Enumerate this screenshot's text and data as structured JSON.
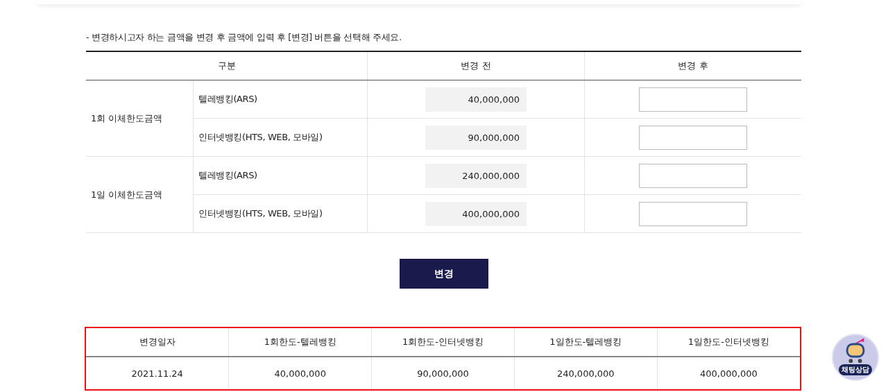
{
  "instruction": "- 변경하시고자 하는 금액을 변경 후 금액에 입력 후 [변경] 버튼을 선택해 주세요.",
  "limit_table": {
    "columns": [
      "구분",
      "변경 전",
      "변경 후"
    ],
    "groups": [
      {
        "label": "1회 이체한도금액",
        "rows": [
          {
            "channel": "텔레뱅킹(ARS)",
            "before": "40,000,000"
          },
          {
            "channel": "인터넷뱅킹(HTS, WEB, 모바일)",
            "before": "90,000,000"
          }
        ]
      },
      {
        "label": "1일 이체한도금액",
        "rows": [
          {
            "channel": "텔레뱅킹(ARS)",
            "before": "240,000,000"
          },
          {
            "channel": "인터넷뱅킹(HTS, WEB, 모바일)",
            "before": "400,000,000"
          }
        ]
      }
    ]
  },
  "change_button": "변경",
  "history_table": {
    "highlighted": true,
    "columns": [
      "변경일자",
      "1회한도-텔레뱅킹",
      "1회한도-인터넷뱅킹",
      "1일한도-텔레뱅킹",
      "1일한도-인터넷뱅킹"
    ],
    "rows": [
      [
        "2021.11.24",
        "40,000,000",
        "90,000,000",
        "240,000,000",
        "400,000,000"
      ]
    ]
  },
  "chat_button": {
    "label": "채팅상담"
  }
}
